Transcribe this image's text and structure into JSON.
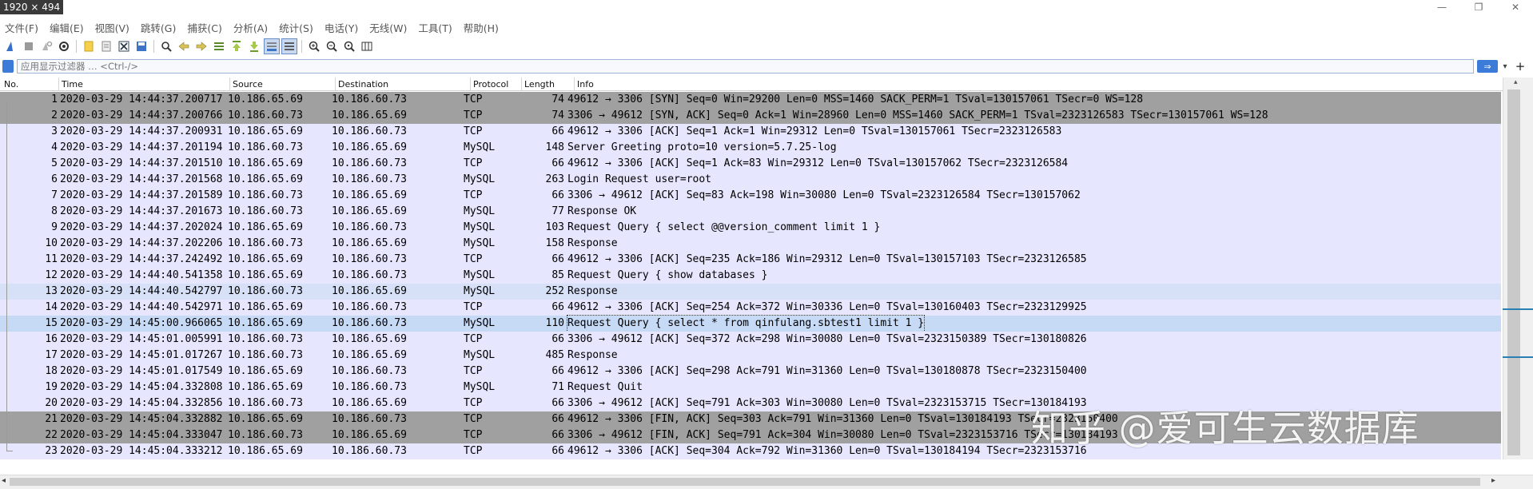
{
  "window": {
    "size_badge": "1920 × 494",
    "controls": {
      "minimize": "—",
      "restore": "❐",
      "close": "✕"
    }
  },
  "menubar": {
    "items": [
      "文件(F)",
      "编辑(E)",
      "视图(V)",
      "跳转(G)",
      "捕获(C)",
      "分析(A)",
      "统计(S)",
      "电话(Y)",
      "无线(W)",
      "工具(T)",
      "帮助(H)"
    ]
  },
  "toolbar": {
    "icons": [
      "shark-fin-start-icon",
      "stop-icon",
      "restart-icon",
      "options-gear-icon",
      "open-file-icon",
      "file-set-icon",
      "close-file-icon",
      "save-icon",
      "find-icon",
      "back-arrow-icon",
      "forward-arrow-icon",
      "go-to-packet-icon",
      "first-packet-icon",
      "last-packet-icon",
      "autoscroll-icon",
      "colorize-icon",
      "zoom-in-icon",
      "zoom-out-icon",
      "normal-size-icon",
      "resize-columns-icon"
    ]
  },
  "filter": {
    "placeholder": "应用显示过滤器 … <Ctrl-/>",
    "apply_arrow": "⇒",
    "dropdown": "▾",
    "add": "+"
  },
  "columns": {
    "no": "No.",
    "time": "Time",
    "source": "Source",
    "destination": "Destination",
    "protocol": "Protocol",
    "length": "Length",
    "info": "Info"
  },
  "colors": {
    "tcp_row": "#e7e6ff",
    "mysql_row": "#e7e6ff",
    "syn_fin_row": "#a0a0a0",
    "selected_row": "#c6d9f5",
    "hover_row": "#d6e0f7"
  },
  "packets": [
    {
      "no": "1",
      "time": "2020-03-29 14:44:37.200717",
      "src": "10.186.65.69",
      "dst": "10.186.60.73",
      "proto": "TCP",
      "len": "74",
      "info": "49612 → 3306 [SYN] Seq=0 Win=29200 Len=0 MSS=1460 SACK_PERM=1 TSval=130157061 TSecr=0 WS=128",
      "style": "syn"
    },
    {
      "no": "2",
      "time": "2020-03-29 14:44:37.200766",
      "src": "10.186.60.73",
      "dst": "10.186.65.69",
      "proto": "TCP",
      "len": "74",
      "info": "3306 → 49612 [SYN, ACK] Seq=0 Ack=1 Win=28960 Len=0 MSS=1460 SACK_PERM=1 TSval=2323126583 TSecr=130157061 WS=128",
      "style": "syn"
    },
    {
      "no": "3",
      "time": "2020-03-29 14:44:37.200931",
      "src": "10.186.65.69",
      "dst": "10.186.60.73",
      "proto": "TCP",
      "len": "66",
      "info": "49612 → 3306 [ACK] Seq=1 Ack=1 Win=29312 Len=0 TSval=130157061 TSecr=2323126583",
      "style": "normal"
    },
    {
      "no": "4",
      "time": "2020-03-29 14:44:37.201194",
      "src": "10.186.60.73",
      "dst": "10.186.65.69",
      "proto": "MySQL",
      "len": "148",
      "info": "Server Greeting proto=10 version=5.7.25-log",
      "style": "normal"
    },
    {
      "no": "5",
      "time": "2020-03-29 14:44:37.201510",
      "src": "10.186.65.69",
      "dst": "10.186.60.73",
      "proto": "TCP",
      "len": "66",
      "info": "49612 → 3306 [ACK] Seq=1 Ack=83 Win=29312 Len=0 TSval=130157062 TSecr=2323126584",
      "style": "normal"
    },
    {
      "no": "6",
      "time": "2020-03-29 14:44:37.201568",
      "src": "10.186.65.69",
      "dst": "10.186.60.73",
      "proto": "MySQL",
      "len": "263",
      "info": "Login Request user=root",
      "style": "normal"
    },
    {
      "no": "7",
      "time": "2020-03-29 14:44:37.201589",
      "src": "10.186.60.73",
      "dst": "10.186.65.69",
      "proto": "TCP",
      "len": "66",
      "info": "3306 → 49612 [ACK] Seq=83 Ack=198 Win=30080 Len=0 TSval=2323126584 TSecr=130157062",
      "style": "normal"
    },
    {
      "no": "8",
      "time": "2020-03-29 14:44:37.201673",
      "src": "10.186.60.73",
      "dst": "10.186.65.69",
      "proto": "MySQL",
      "len": "77",
      "info": "Response OK",
      "style": "normal"
    },
    {
      "no": "9",
      "time": "2020-03-29 14:44:37.202024",
      "src": "10.186.65.69",
      "dst": "10.186.60.73",
      "proto": "MySQL",
      "len": "103",
      "info": "Request Query { select @@version_comment limit 1 }",
      "style": "normal"
    },
    {
      "no": "10",
      "time": "2020-03-29 14:44:37.202206",
      "src": "10.186.60.73",
      "dst": "10.186.65.69",
      "proto": "MySQL",
      "len": "158",
      "info": "Response",
      "style": "normal"
    },
    {
      "no": "11",
      "time": "2020-03-29 14:44:37.242492",
      "src": "10.186.65.69",
      "dst": "10.186.60.73",
      "proto": "TCP",
      "len": "66",
      "info": "49612 → 3306 [ACK] Seq=235 Ack=186 Win=29312 Len=0 TSval=130157103 TSecr=2323126585",
      "style": "normal"
    },
    {
      "no": "12",
      "time": "2020-03-29 14:44:40.541358",
      "src": "10.186.65.69",
      "dst": "10.186.60.73",
      "proto": "MySQL",
      "len": "85",
      "info": "Request Query { show databases }",
      "style": "normal"
    },
    {
      "no": "13",
      "time": "2020-03-29 14:44:40.542797",
      "src": "10.186.60.73",
      "dst": "10.186.65.69",
      "proto": "MySQL",
      "len": "252",
      "info": "Response",
      "style": "hover"
    },
    {
      "no": "14",
      "time": "2020-03-29 14:44:40.542971",
      "src": "10.186.65.69",
      "dst": "10.186.60.73",
      "proto": "TCP",
      "len": "66",
      "info": "49612 → 3306 [ACK] Seq=254 Ack=372 Win=30336 Len=0 TSval=130160403 TSecr=2323129925",
      "style": "normal"
    },
    {
      "no": "15",
      "time": "2020-03-29 14:45:00.966065",
      "src": "10.186.65.69",
      "dst": "10.186.60.73",
      "proto": "MySQL",
      "len": "110",
      "info": "Request Query { select * from qinfulang.sbtest1 limit 1 }",
      "style": "selected"
    },
    {
      "no": "16",
      "time": "2020-03-29 14:45:01.005991",
      "src": "10.186.60.73",
      "dst": "10.186.65.69",
      "proto": "TCP",
      "len": "66",
      "info": "3306 → 49612 [ACK] Seq=372 Ack=298 Win=30080 Len=0 TSval=2323150389 TSecr=130180826",
      "style": "normal"
    },
    {
      "no": "17",
      "time": "2020-03-29 14:45:01.017267",
      "src": "10.186.60.73",
      "dst": "10.186.65.69",
      "proto": "MySQL",
      "len": "485",
      "info": "Response",
      "style": "normal"
    },
    {
      "no": "18",
      "time": "2020-03-29 14:45:01.017549",
      "src": "10.186.65.69",
      "dst": "10.186.60.73",
      "proto": "TCP",
      "len": "66",
      "info": "49612 → 3306 [ACK] Seq=298 Ack=791 Win=31360 Len=0 TSval=130180878 TSecr=2323150400",
      "style": "normal"
    },
    {
      "no": "19",
      "time": "2020-03-29 14:45:04.332808",
      "src": "10.186.65.69",
      "dst": "10.186.60.73",
      "proto": "MySQL",
      "len": "71",
      "info": "Request Quit",
      "style": "normal"
    },
    {
      "no": "20",
      "time": "2020-03-29 14:45:04.332856",
      "src": "10.186.60.73",
      "dst": "10.186.65.69",
      "proto": "TCP",
      "len": "66",
      "info": "3306 → 49612 [ACK] Seq=791 Ack=303 Win=30080 Len=0 TSval=2323153715 TSecr=130184193",
      "style": "normal"
    },
    {
      "no": "21",
      "time": "2020-03-29 14:45:04.332882",
      "src": "10.186.65.69",
      "dst": "10.186.60.73",
      "proto": "TCP",
      "len": "66",
      "info": "49612 → 3306 [FIN, ACK] Seq=303 Ack=791 Win=31360 Len=0 TSval=130184193 TSecr=2323150400",
      "style": "syn"
    },
    {
      "no": "22",
      "time": "2020-03-29 14:45:04.333047",
      "src": "10.186.60.73",
      "dst": "10.186.65.69",
      "proto": "TCP",
      "len": "66",
      "info": "3306 → 49612 [FIN, ACK] Seq=791 Ack=304 Win=30080 Len=0 TSval=2323153716 TSecr=130184193",
      "style": "syn"
    },
    {
      "no": "23",
      "time": "2020-03-29 14:45:04.333212",
      "src": "10.186.65.69",
      "dst": "10.186.60.73",
      "proto": "TCP",
      "len": "66",
      "info": "49612 → 3306 [ACK] Seq=304 Ack=792 Win=31360 Len=0 TSval=130184194 TSecr=2323153716",
      "style": "normal"
    }
  ],
  "watermark": "知乎 @爱可生云数据库",
  "scroll": {
    "left_arrow": "◂",
    "right_arrow": "▸",
    "up_arrow": "▴"
  }
}
